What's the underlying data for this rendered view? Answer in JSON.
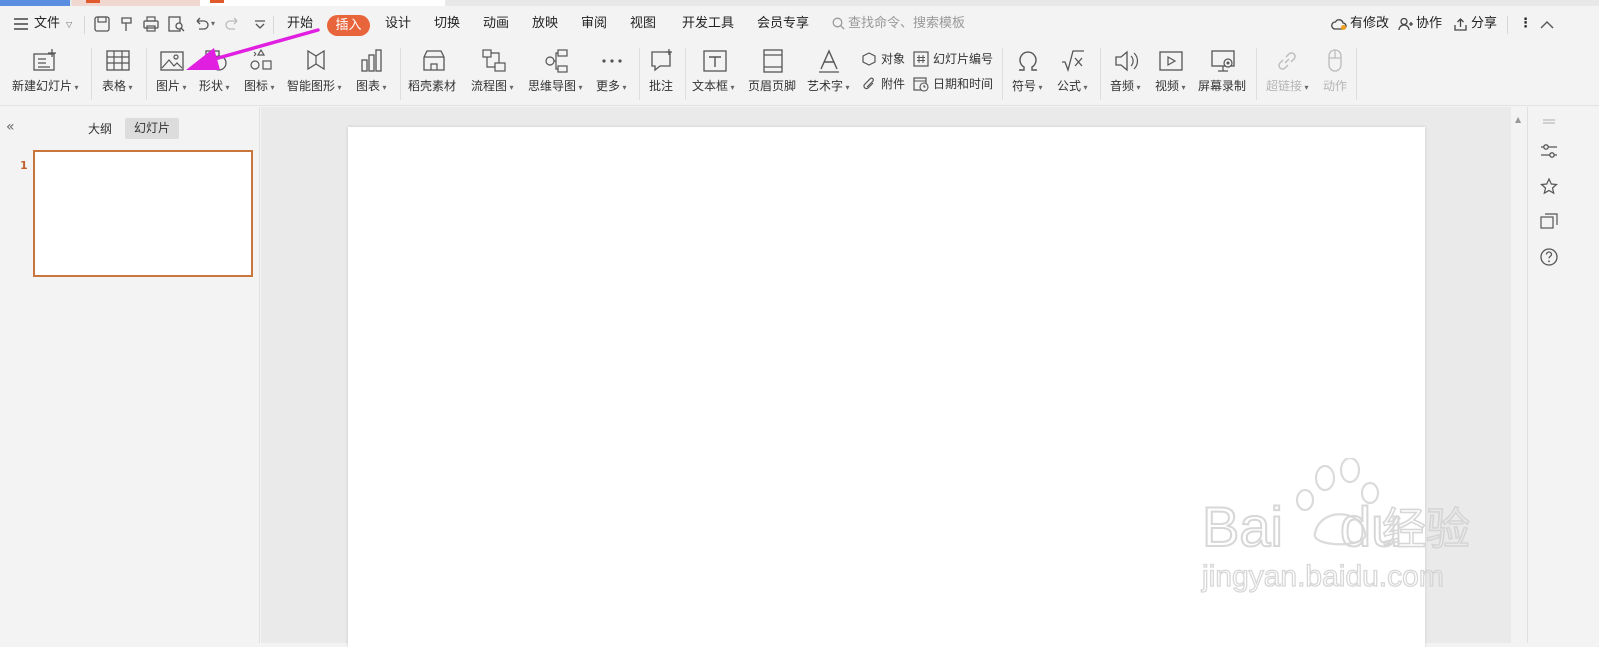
{
  "menubar": {
    "file": "文件",
    "tabs": [
      "开始",
      "插入",
      "设计",
      "切换",
      "动画",
      "放映",
      "审阅",
      "视图",
      "开发工具",
      "会员专享"
    ],
    "active_tab": "插入",
    "search_placeholder": "查找命令、搜索模板",
    "modified": "有修改",
    "collaborate": "协作",
    "share": "分享"
  },
  "ribbon": {
    "new_slide": "新建幻灯片",
    "table": "表格",
    "picture": "图片",
    "shape": "形状",
    "icon": "图标",
    "smartart": "智能图形",
    "chart": "图表",
    "material": "稻壳素材",
    "flowchart": "流程图",
    "mindmap": "思维导图",
    "more": "更多",
    "comment": "批注",
    "textbox": "文本框",
    "header_footer": "页眉页脚",
    "wordart": "艺术字",
    "object": "对象",
    "attachment": "附件",
    "slide_number": "幻灯片编号",
    "datetime": "日期和时间",
    "symbol": "符号",
    "formula": "公式",
    "audio": "音频",
    "video": "视频",
    "screen_record": "屏幕录制",
    "hyperlink": "超链接",
    "action": "动作"
  },
  "leftpanel": {
    "outline_tab": "大纲",
    "slides_tab": "幻灯片",
    "slides": [
      {
        "number": "1"
      }
    ]
  },
  "watermark": {
    "brand": "Bai",
    "brand2": "du",
    "brand_cn": "经验",
    "url": "jingyan.baidu.com"
  },
  "colors": {
    "accent": "#e8643a",
    "arrow": "#e01fe0",
    "thumb_border": "#c8763c"
  }
}
